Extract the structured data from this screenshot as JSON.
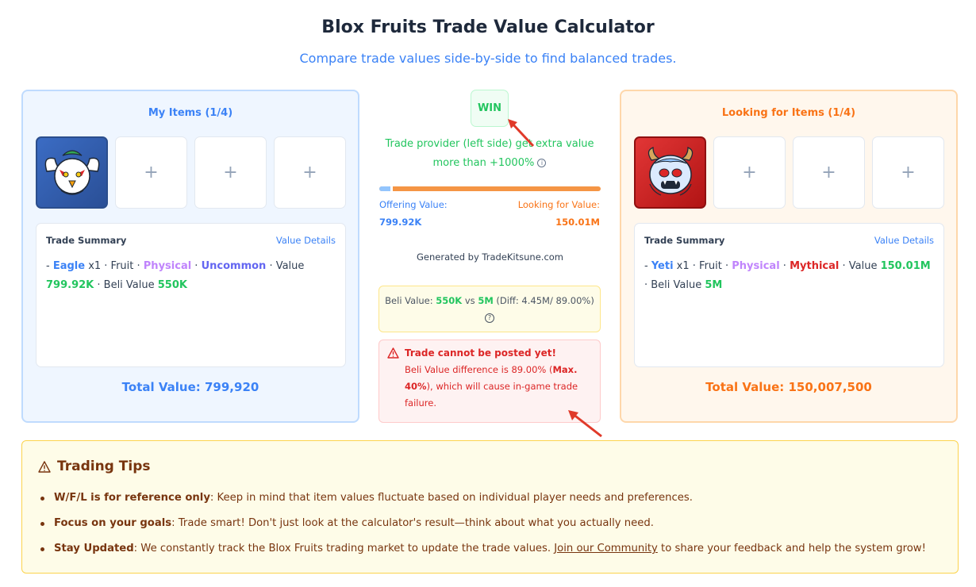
{
  "header": {
    "title": "Blox Fruits Trade Value Calculator",
    "subtitle": "Compare trade values side-by-side to find balanced trades."
  },
  "my_panel": {
    "title": "My Items (1/4)",
    "summary_title": "Trade Summary",
    "value_details": "Value Details",
    "item": {
      "dash": "- ",
      "name": "Eagle",
      "qty": " x1 · Fruit · ",
      "type": "Physical",
      "sep": " · ",
      "rarity": "Uncommon",
      "value_label": " · Value ",
      "value": "799.92K",
      "beli_label": " · Beli Value ",
      "beli": "550K"
    },
    "total_label": "Total Value: 799,920",
    "empty_slot": "+"
  },
  "look_panel": {
    "title": "Looking for Items (1/4)",
    "summary_title": "Trade Summary",
    "value_details": "Value Details",
    "item": {
      "dash": "- ",
      "name": "Yeti",
      "qty": " x1 · Fruit · ",
      "type": "Physical",
      "sep": " · ",
      "rarity": "Mythical",
      "value_label": " · Value ",
      "value": "150.01M",
      "beli_label": " · Beli Value ",
      "beli": "5M"
    },
    "total_label": "Total Value: 150,007,500",
    "empty_slot": "+"
  },
  "center": {
    "result": "WIN",
    "result_desc": "Trade provider (left side) get extra value more than +1000%",
    "info_glyph": "i",
    "offering_label": "Offering Value:",
    "offering_value": "799.92K",
    "looking_label": "Looking for Value:",
    "looking_value": "150.01M",
    "offer_fraction": 0.005,
    "generated": "Generated by TradeKitsune.com",
    "beli": {
      "prefix": "Beli Value: ",
      "left": "550K",
      "vs": " vs ",
      "right": "5M",
      "diff": " (Diff: 4.45M/ 89.00%)",
      "help_glyph": "?"
    },
    "warning": {
      "title": "Trade cannot be posted yet!",
      "body_pre": "Beli Value difference is 89.00% (",
      "body_bold": "Max. 40%",
      "body_post": "), which will cause in-game trade failure."
    }
  },
  "tips": {
    "title": "Trading Tips",
    "items": [
      {
        "bold": "W/F/L is for reference only",
        "text": ": Keep in mind that item values fluctuate based on individual player needs and preferences."
      },
      {
        "bold": "Focus on your goals",
        "text": ": Trade smart! Don't just look at the calculator's result—think about what you actually need."
      },
      {
        "bold": "Stay Updated",
        "text": ": We constantly track the Blox Fruits trading market to update the trade values. ",
        "link": "Join our Community",
        "after": " to share your feedback and help the system grow!"
      }
    ]
  },
  "colors": {
    "accent_blue": "#3b82f6",
    "accent_orange": "#f97316",
    "win_green": "#22c55e",
    "error_red": "#dc2626",
    "arrow_red": "#e03a2a"
  },
  "icons": {
    "eagle_slot": "eagle-fruit-icon",
    "yeti_slot": "yeti-fruit-icon",
    "warning": "warning-triangle-icon",
    "tips": "alert-triangle-icon"
  }
}
